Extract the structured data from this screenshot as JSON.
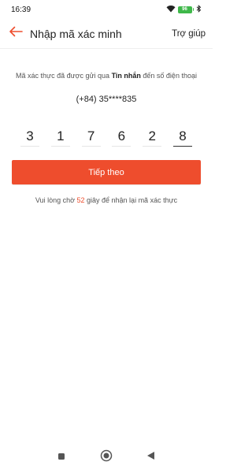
{
  "status_bar": {
    "time": "16:39",
    "battery": "96"
  },
  "app_bar": {
    "title": "Nhập mã xác minh",
    "help_label": "Trợ giúp"
  },
  "verification": {
    "info_prefix": "Mã xác thực đã được gửi qua ",
    "info_channel": "Tin nhắn",
    "info_suffix": " đến số điện thoại",
    "phone_number": "(+84) 35****835",
    "otp_digits": [
      "3",
      "1",
      "7",
      "6",
      "2",
      "8"
    ]
  },
  "next_button": {
    "label": "Tiếp theo"
  },
  "resend": {
    "prefix": "Vui lòng chờ ",
    "seconds": "52",
    "suffix": " giây để nhận lại mã xác thực"
  },
  "colors": {
    "accent": "#ee4d2d",
    "battery": "#3fb84a"
  },
  "icons": {
    "back": "arrow-left-icon",
    "wifi": "wifi-icon",
    "bluetooth": "bluetooth-icon",
    "nav_recent": "square-icon",
    "nav_home": "circle-icon",
    "nav_back": "triangle-left-icon"
  }
}
